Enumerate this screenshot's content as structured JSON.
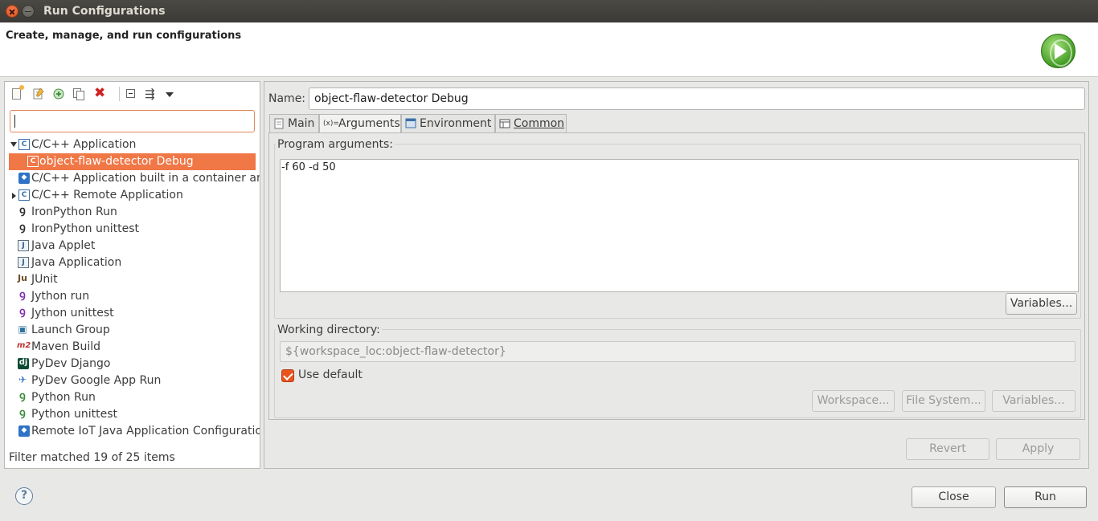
{
  "window": {
    "title": "Run Configurations"
  },
  "header": {
    "description": "Create, manage, and run configurations"
  },
  "sidebar": {
    "filter_value": "",
    "tree": [
      {
        "label": "C/C++ Application",
        "icon": "c-app-icon",
        "expanded": true
      },
      {
        "label": "object-flaw-detector Debug",
        "icon": "c-app-icon",
        "selected": true
      },
      {
        "label": "C/C++ Application built in a container and",
        "icon": "container-icon"
      },
      {
        "label": "C/C++ Remote Application",
        "icon": "c-app-icon",
        "expanded": false
      },
      {
        "label": "IronPython Run",
        "icon": "ironpython-icon"
      },
      {
        "label": "IronPython unittest",
        "icon": "ironpython-unittest-icon"
      },
      {
        "label": "Java Applet",
        "icon": "java-applet-icon"
      },
      {
        "label": "Java Application",
        "icon": "java-app-icon"
      },
      {
        "label": "JUnit",
        "icon": "junit-icon"
      },
      {
        "label": "Jython run",
        "icon": "jython-icon"
      },
      {
        "label": "Jython unittest",
        "icon": "jython-unittest-icon"
      },
      {
        "label": "Launch Group",
        "icon": "launch-group-icon"
      },
      {
        "label": "Maven Build",
        "icon": "maven-icon"
      },
      {
        "label": "PyDev Django",
        "icon": "django-icon"
      },
      {
        "label": "PyDev Google App Run",
        "icon": "google-app-icon"
      },
      {
        "label": "Python Run",
        "icon": "python-icon"
      },
      {
        "label": "Python unittest",
        "icon": "python-unittest-icon"
      },
      {
        "label": "Remote IoT Java Application Configuratio",
        "icon": "iot-icon"
      }
    ],
    "status": "Filter matched 19 of 25 items"
  },
  "editor": {
    "name_label": "Name:",
    "name_value": "object-flaw-detector Debug",
    "tabs": [
      {
        "label": "Main"
      },
      {
        "label": "Arguments"
      },
      {
        "label": "Environment"
      },
      {
        "label": "Common"
      }
    ],
    "program_args_label": "Program arguments:",
    "program_args_value": "-f 60 -d 50",
    "variables_label": "Variables...",
    "working_dir_label": "Working directory:",
    "working_dir_value": "${workspace_loc:object-flaw-detector}",
    "use_default_label": "Use default",
    "workspace_label": "Workspace...",
    "filesystem_label": "File System...",
    "variables2_label": "Variables...",
    "revert_label": "Revert",
    "apply_label": "Apply"
  },
  "footer": {
    "close_label": "Close",
    "run_label": "Run"
  },
  "colors": {
    "accent": "#f07746",
    "checkbox": "#e9541d"
  }
}
